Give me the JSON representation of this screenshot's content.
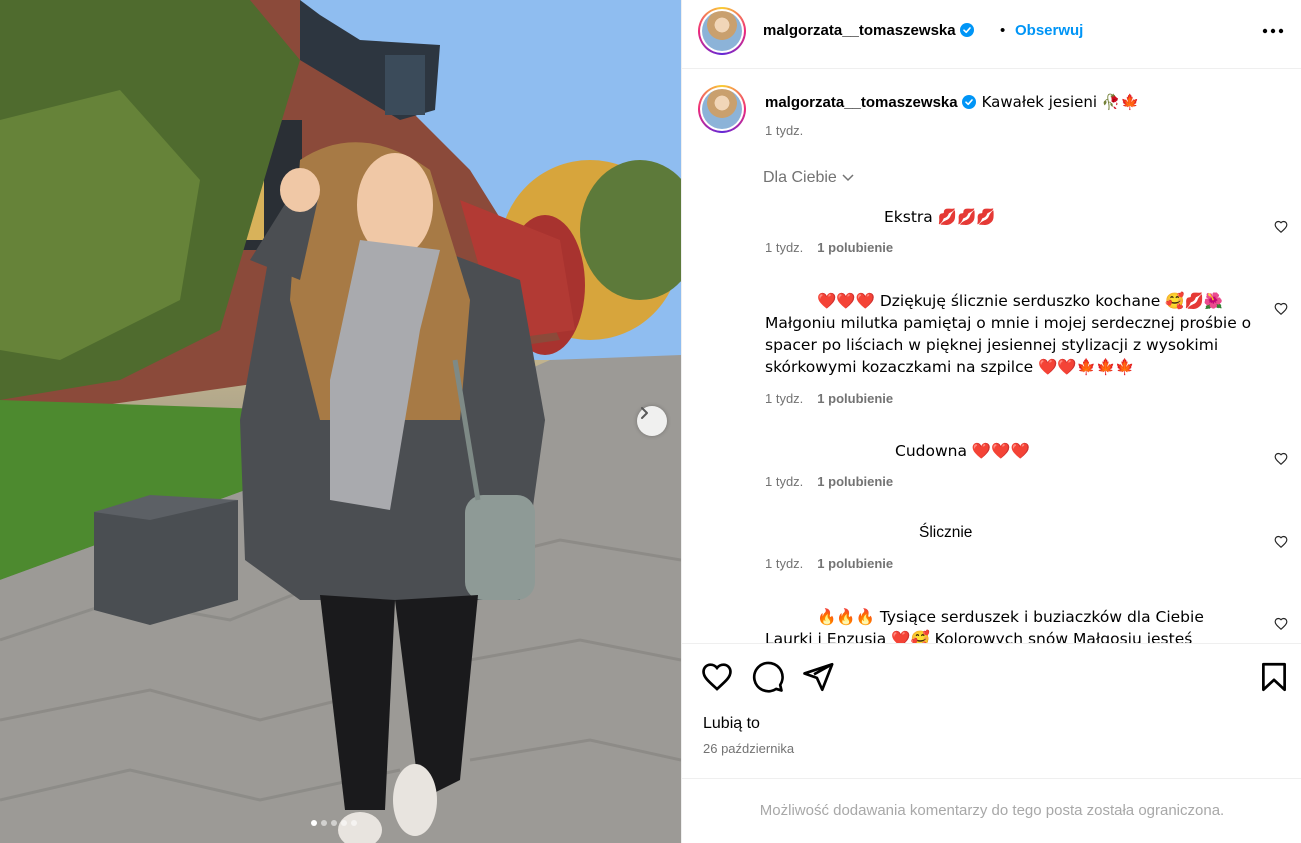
{
  "post": {
    "username": "malgorzata__tomaszewska",
    "follow_label": "Obserwuj",
    "separator": "•",
    "caption": "Kawałek jesieni 🥀🍁",
    "caption_time": "1 tydz.",
    "filter_label": "Dla Ciebie",
    "carousel": {
      "slide_count": 5,
      "active_slide": 1
    }
  },
  "comments": [
    {
      "text": "Ekstra 💋💋💋",
      "time": "1 tydz.",
      "likes": "1 polubienie"
    },
    {
      "text": "❤️❤️❤️ Dziękuję ślicznie serduszko kochane 🥰💋🌺 Małgoniu milutka pamiętaj o mnie i mojej serdecznej prośbie o spacer po liściach w pięknej jesiennej stylizacji z wysokimi skórkowymi kozaczkami na szpilce ❤️❤️🍁🍁🍁",
      "time": "1 tydz.",
      "likes": "1 polubienie"
    },
    {
      "text": "Cudowna ❤️❤️❤️",
      "time": "1 tydz.",
      "likes": "1 polubienie"
    },
    {
      "text": "Ślicznie",
      "time": "1 tydz.",
      "likes": "1 polubienie"
    },
    {
      "text": "🔥🔥🔥 Tysiące serduszek i buziaczków dla Ciebie Laurki i Enzusia ❤️🥰 Kolorowych snów Małgosiu jesteś",
      "time": "",
      "likes": ""
    }
  ],
  "footer": {
    "liked_by": "Lubią to",
    "date": "26 października",
    "comments_limited": "Możliwość dodawania komentarzy do tego posta została ograniczona."
  },
  "icons": [
    "more-options-icon",
    "verified-badge-icon",
    "chevron-down-icon",
    "like-icon",
    "comment-icon",
    "share-icon",
    "save-icon",
    "next-slide-icon"
  ],
  "colors": {
    "follow": "#0095f6",
    "muted": "#737373",
    "disabled": "#a8a8a8",
    "verified": "#0095f6"
  }
}
